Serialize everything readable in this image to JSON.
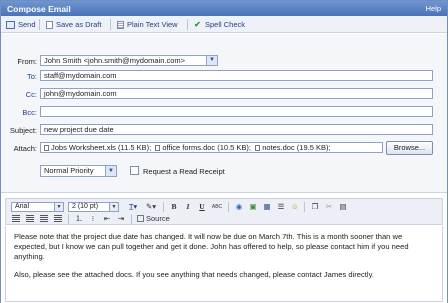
{
  "window": {
    "title": "Compose Email",
    "help": "Help"
  },
  "toolbar": {
    "send": "Send",
    "save_draft": "Save as Draft",
    "plain_text": "Plain Text View",
    "spell_check": "Spell Check"
  },
  "form": {
    "from_label": "From:",
    "from_value": "John Smith <john.smith@mydomain.com>",
    "to_label": "To:",
    "to_value": "staff@mydomain.com",
    "cc_label": "Cc:",
    "cc_value": "john@mydomain.com",
    "bcc_label": "Bcc:",
    "bcc_value": "",
    "subject_label": "Subject:",
    "subject_value": "new project due date",
    "attach_label": "Attach:",
    "attachments": [
      "Jobs Worksheet.xls (11.5 KB);",
      "office forms.doc (10.5 KB);",
      "notes.doc (19.5 KB);"
    ],
    "browse": "Browse...",
    "priority": "Normal Priority",
    "read_receipt": "Request a Read Receipt"
  },
  "editor": {
    "font": "Arial",
    "size": "2 (10 pt)",
    "source": "Source",
    "body": [
      "Please note that the project due date has changed. It will now be due on March 7th. This is a month sooner than we expected, but I know we can pull together and get it done. John has offered to help, so please contact him if you need anything.",
      "Also, please see the attached docs. If you see anything that needs changed, please contact James directly."
    ]
  },
  "colors": {
    "accent": "#4a73b8",
    "link": "#1f3f86",
    "form_bg": "#f4f6fa"
  }
}
